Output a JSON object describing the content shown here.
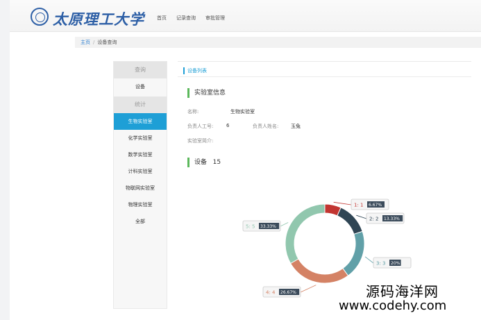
{
  "header": {
    "logo_text": "太原理工大学",
    "nav": [
      "首页",
      "记录查询",
      "审批管理"
    ]
  },
  "breadcrumb": {
    "home": "主页",
    "current": "设备查询"
  },
  "sidebar": {
    "query_label": "查询",
    "query_items": [
      "设备"
    ],
    "stat_label": "统计",
    "labs": [
      "生物实验室",
      "化学实验室",
      "数学实验室",
      "计科实验室",
      "物联网实验室",
      "物理实验室",
      "全部"
    ],
    "active_index": 0
  },
  "tab": {
    "label": "设备列表"
  },
  "lab_info": {
    "title": "实验室信息",
    "name_label": "名称:",
    "name_value": "生物实验室",
    "staff_id_label": "负责人工号:",
    "staff_id_value": "6",
    "staff_name_label": "负责人姓名:",
    "staff_name_value": "玉兔",
    "intro_label": "实验室简介:"
  },
  "equipment": {
    "title": "设备",
    "count": "15"
  },
  "colors": {
    "accent": "#1e9fd6",
    "section_bar": "#5cb85c"
  },
  "chart_data": {
    "type": "pie",
    "donut": true,
    "categories": [
      "1",
      "2",
      "3",
      "4",
      "5"
    ],
    "values": [
      1,
      2,
      3,
      4,
      5
    ],
    "labels": [
      "1: 1",
      "2: 2",
      "3: 3",
      "4: 4",
      "5: 5"
    ],
    "percents": [
      "6.67%",
      "13.33%",
      "20%",
      "26.67%",
      "33.33%"
    ],
    "colors": [
      "#c23531",
      "#2f4554",
      "#61a0a8",
      "#d48265",
      "#91c7ae"
    ]
  },
  "watermark": {
    "line1": "源码海洋网",
    "line2": "www.codehy.com"
  }
}
